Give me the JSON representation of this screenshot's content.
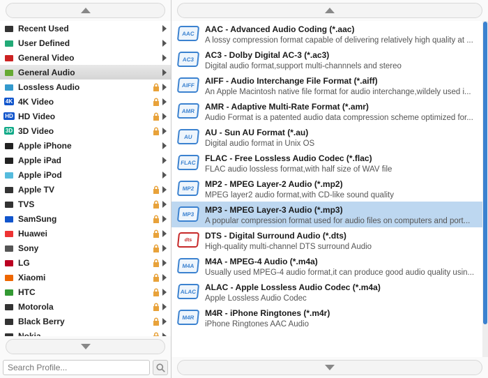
{
  "search": {
    "placeholder": "Search Profile..."
  },
  "categories": [
    {
      "label": "Recent Used",
      "icon_color": "#333",
      "badge": "",
      "locked": false
    },
    {
      "label": "User Defined",
      "icon_color": "#2a7",
      "badge": "",
      "locked": false
    },
    {
      "label": "General Video",
      "icon_color": "#c22",
      "badge": "",
      "locked": false
    },
    {
      "label": "General Audio",
      "icon_color": "#6a3",
      "badge": "",
      "locked": false,
      "selected": true
    },
    {
      "label": "Lossless Audio",
      "icon_color": "#39c",
      "badge": "",
      "locked": true
    },
    {
      "label": "4K Video",
      "icon_color": "#15c",
      "badge": "4K",
      "locked": true
    },
    {
      "label": "HD Video",
      "icon_color": "#15c",
      "badge": "HD",
      "locked": true
    },
    {
      "label": "3D Video",
      "icon_color": "#1a8",
      "badge": "3D",
      "locked": true
    },
    {
      "label": "Apple iPhone",
      "icon_color": "#222",
      "badge": "",
      "locked": false
    },
    {
      "label": "Apple iPad",
      "icon_color": "#222",
      "badge": "",
      "locked": false
    },
    {
      "label": "Apple iPod",
      "icon_color": "#5bd",
      "badge": "",
      "locked": false
    },
    {
      "label": "Apple TV",
      "icon_color": "#333",
      "badge": "",
      "locked": true
    },
    {
      "label": "TVS",
      "icon_color": "#333",
      "badge": "",
      "locked": true
    },
    {
      "label": "SamSung",
      "icon_color": "#15c",
      "badge": "",
      "locked": true
    },
    {
      "label": "Huawei",
      "icon_color": "#e33",
      "badge": "",
      "locked": true
    },
    {
      "label": "Sony",
      "icon_color": "#555",
      "badge": "",
      "locked": true
    },
    {
      "label": "LG",
      "icon_color": "#b02",
      "badge": "",
      "locked": true
    },
    {
      "label": "Xiaomi",
      "icon_color": "#e60",
      "badge": "",
      "locked": true
    },
    {
      "label": "HTC",
      "icon_color": "#393",
      "badge": "",
      "locked": true
    },
    {
      "label": "Motorola",
      "icon_color": "#333",
      "badge": "",
      "locked": true
    },
    {
      "label": "Black Berry",
      "icon_color": "#333",
      "badge": "",
      "locked": true
    },
    {
      "label": "Nokia",
      "icon_color": "#333",
      "badge": "",
      "locked": true
    }
  ],
  "formats": [
    {
      "tag": "AAC",
      "title": "AAC - Advanced Audio Coding (*.aac)",
      "desc": "A lossy compression format capable of delivering relatively high quality at ..."
    },
    {
      "tag": "AC3",
      "title": "AC3 - Dolby Digital AC-3 (*.ac3)",
      "desc": "Digital audio format,support multi-channnels and stereo"
    },
    {
      "tag": "AIFF",
      "title": "AIFF - Audio Interchange File Format (*.aiff)",
      "desc": "An Apple Macintosh native file format for audio interchange,wildely used i..."
    },
    {
      "tag": "AMR",
      "title": "AMR - Adaptive Multi-Rate Format (*.amr)",
      "desc": "Audio Format is a patented audio data compression scheme optimized for..."
    },
    {
      "tag": "AU",
      "title": "AU - Sun AU Format (*.au)",
      "desc": "Digital audio format in Unix OS"
    },
    {
      "tag": "FLAC",
      "title": "FLAC - Free Lossless Audio Codec (*.flac)",
      "desc": "FLAC audio lossless format,with half size of WAV file"
    },
    {
      "tag": "MP2",
      "title": "MP2 - MPEG Layer-2 Audio (*.mp2)",
      "desc": "MPEG layer2 audio format,with CD-like sound quality"
    },
    {
      "tag": "MP3",
      "title": "MP3 - MPEG Layer-3 Audio (*.mp3)",
      "desc": "A popular compression format used for audio files on computers and port...",
      "selected": true
    },
    {
      "tag": "dts",
      "title": "DTS - Digital Surround Audio (*.dts)",
      "desc": "High-quality multi-channel DTS surround Audio",
      "style": "dts"
    },
    {
      "tag": "M4A",
      "title": "M4A - MPEG-4 Audio (*.m4a)",
      "desc": "Usually used MPEG-4 audio format,it can produce good audio quality usin..."
    },
    {
      "tag": "ALAC",
      "title": "ALAC - Apple Lossless Audio Codec (*.m4a)",
      "desc": "Apple Lossless Audio Codec"
    },
    {
      "tag": "M4R",
      "title": "M4R - iPhone Ringtones (*.m4r)",
      "desc": "iPhone Ringtones AAC Audio"
    }
  ]
}
